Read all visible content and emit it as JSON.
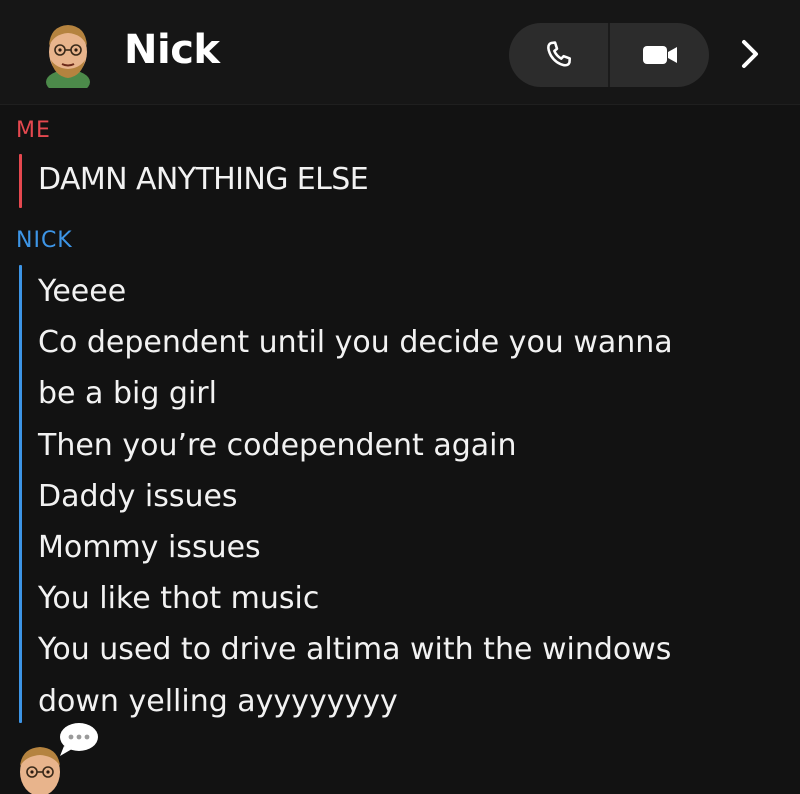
{
  "header": {
    "contact_name": "Nick",
    "avatar_icon": "bitmoji-avatar-icon",
    "call_icon": "phone-icon",
    "video_icon": "video-camera-icon",
    "more_icon": "chevron-right-icon"
  },
  "messages": [
    {
      "sender": "ME",
      "color": "#e5484f",
      "lines": [
        "DAMN ANYTHING ELSE"
      ]
    },
    {
      "sender": "NICK",
      "color": "#3d95e6",
      "lines": [
        "Yeeee",
        "Co dependent until you decide you wanna",
        "be a big girl",
        "Then you’re codependent again",
        "Daddy issues",
        "Mommy issues",
        "You like thot music",
        "You used to drive altima with the windows",
        "down yelling ayyyyyyyy"
      ]
    }
  ],
  "typing_indicator": {
    "avatar_icon": "bitmoji-avatar-icon",
    "bubble_icon": "typing-dots-icon"
  },
  "colors": {
    "background": "#121212",
    "me_accent": "#e5484f",
    "nick_accent": "#3d95e6",
    "pill_background": "#2c2c2c"
  }
}
